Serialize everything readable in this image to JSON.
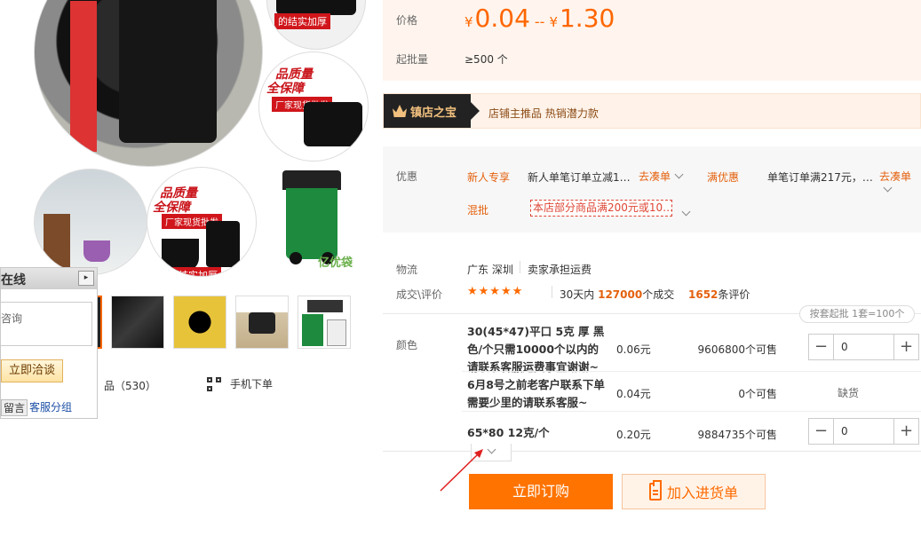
{
  "gallery": {
    "promo_text": "品质量",
    "promo_text2": "全保障",
    "badge": "厂家现货批发",
    "strip": "的结实加厚",
    "bin_logo": "亿优袋",
    "shop_items": "品（530）",
    "mobile_order": "手机下单"
  },
  "chat": {
    "title": "在线",
    "close": "▸",
    "input_placeholder": "咨询",
    "button": "立即洽谈",
    "leave_msg": "留言",
    "service_group": "客服分组"
  },
  "price": {
    "label": "价格",
    "currency": "¥",
    "min": "0.04",
    "range_sep": "--",
    "max": "1.30",
    "moq_label": "起批量",
    "moq_value": "≥500 个"
  },
  "treasure": {
    "tag": "镇店之宝",
    "text": "店铺主推品  热销潜力款"
  },
  "promo": {
    "label": "优惠",
    "new_label": "新人专享",
    "new_text": "新人单笔订单立减1…",
    "new_action": "去凑单",
    "full_label": "满优惠",
    "full_text": "单笔订单满217元，…",
    "full_action": "去凑单",
    "mix_label": "混批",
    "mix_text": "本店部分商品满200元或10…"
  },
  "logistics": {
    "label": "物流",
    "from": "广东 深圳",
    "shipping": "卖家承担运费",
    "deal_label": "成交\\评价",
    "stars": "★★★★★",
    "sales_prefix": "30天内",
    "sales_count": "127000",
    "sales_suffix": "个成交",
    "reviews": "1652",
    "reviews_suffix": "条评价"
  },
  "sku": {
    "label": "颜色",
    "pack_note": "按套起批 1套=100个",
    "rows": [
      {
        "name": "30(45*47)平口 5克 厚 黑色/个只需10000个以内的 请联系客服运费事宜谢谢~",
        "price": "0.06元",
        "stock": "9606800个可售",
        "qty": "0"
      },
      {
        "name": "6月8号之前老客户联系下单需要少里的请联系客服~",
        "price": "0.04元",
        "stock": "0个可售",
        "status": "缺货"
      },
      {
        "name": "65*80 12克/个",
        "price": "0.20元",
        "stock": "9884735个可售",
        "qty": "0"
      }
    ],
    "minus": "−",
    "plus": "+"
  },
  "actions": {
    "buy_now": "立即订购",
    "add_cart": "加入进货单"
  },
  "colors": {
    "accent": "#ff6600",
    "price_bg": "#fff5ee",
    "buy_bg": "#ff7300"
  }
}
